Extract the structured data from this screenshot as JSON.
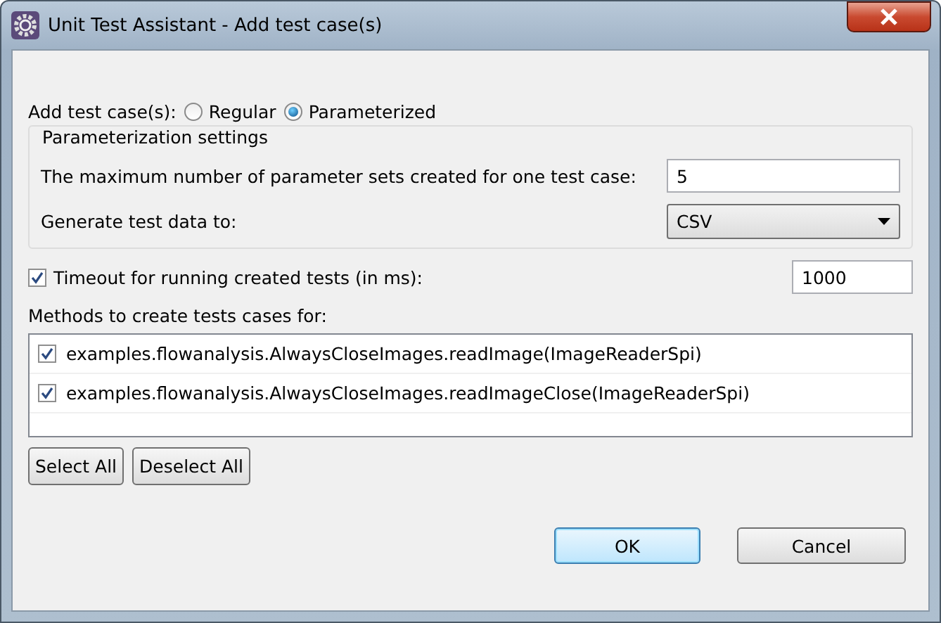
{
  "window": {
    "title": "Unit Test Assistant - Add test case(s)"
  },
  "mode": {
    "label": "Add test case(s):",
    "options": [
      {
        "label": "Regular",
        "selected": false
      },
      {
        "label": "Parameterized",
        "selected": true
      }
    ]
  },
  "parameterization": {
    "title": "Parameterization settings",
    "max_sets": {
      "label": "The maximum number of parameter sets created for one test case:",
      "value": "5"
    },
    "generate_to": {
      "label": "Generate test data to:",
      "value": "CSV"
    }
  },
  "timeout": {
    "label": "Timeout for running created tests (in ms):",
    "checked": true,
    "value": "1000"
  },
  "methods": {
    "label": "Methods to create tests cases for:",
    "items": [
      {
        "label": "examples.flowanalysis.AlwaysCloseImages.readImage(ImageReaderSpi)",
        "checked": true
      },
      {
        "label": "examples.flowanalysis.AlwaysCloseImages.readImageClose(ImageReaderSpi)",
        "checked": true
      }
    ]
  },
  "selection_buttons": [
    "Select All",
    "Deselect All"
  ],
  "buttons": [
    {
      "label": "OK",
      "default": true
    },
    {
      "label": "Cancel",
      "default": false
    }
  ]
}
